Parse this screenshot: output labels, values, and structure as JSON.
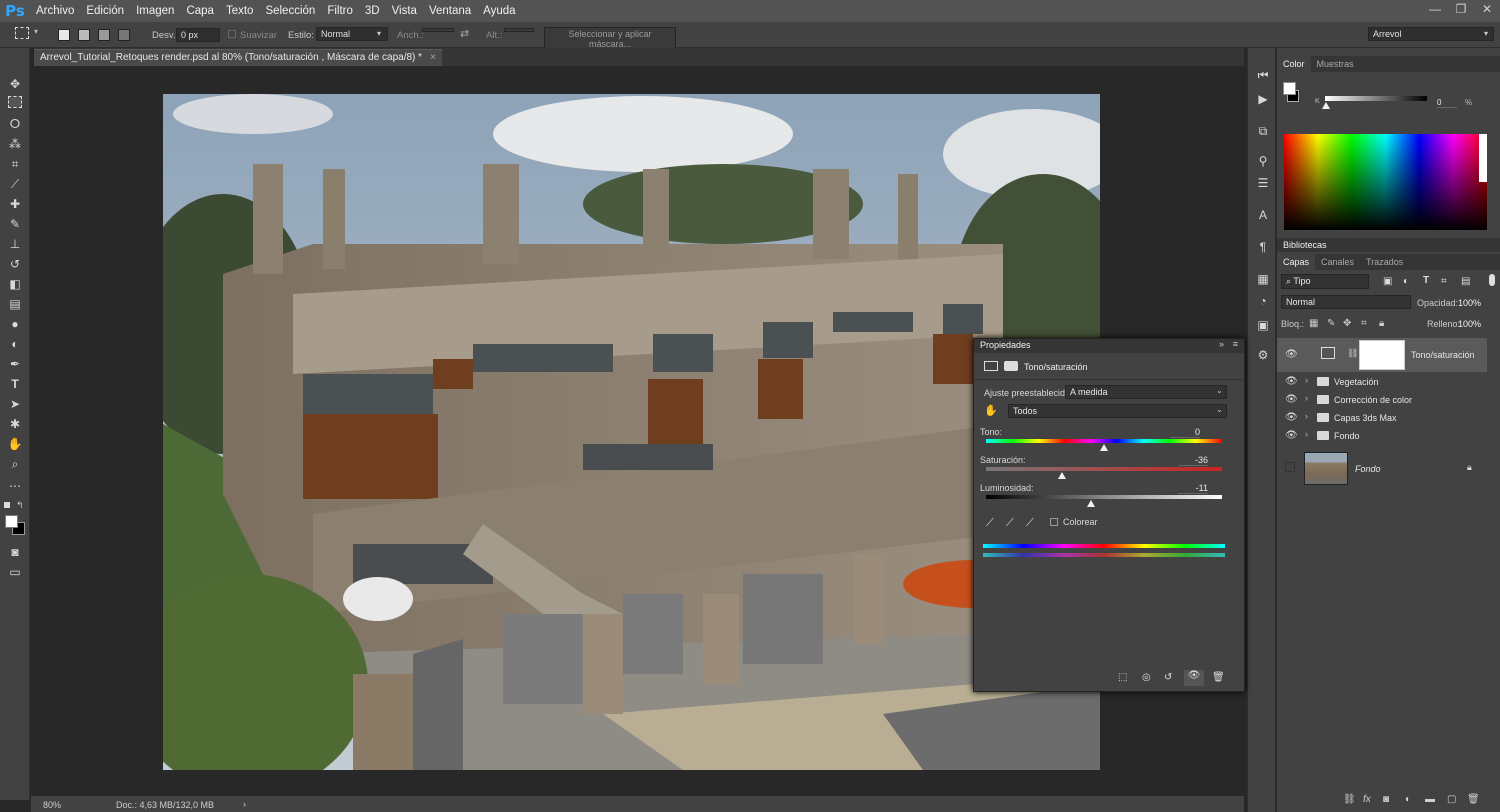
{
  "app": {
    "logo": "Ps"
  },
  "menu": [
    "Archivo",
    "Edición",
    "Imagen",
    "Capa",
    "Texto",
    "Selección",
    "Filtro",
    "3D",
    "Vista",
    "Ventana",
    "Ayuda"
  ],
  "window_controls": [
    "—",
    "❐",
    "✕"
  ],
  "options": {
    "feather_label": "Desv.:",
    "feather_value": "0 px",
    "smooth_label": "Suavizar",
    "style_label": "Estilo:",
    "style_value": "Normal",
    "width_label": "Anch.:",
    "height_label": "Alt.:",
    "mask_button": "Seleccionar y aplicar máscara...",
    "workspace": "Arrevol"
  },
  "document": {
    "tab_title": "Arrevol_Tutorial_Retoques render.psd al 80% (Tono/saturación , Máscara de capa/8) *",
    "close": "×"
  },
  "status": {
    "zoom": "80%",
    "doc": "Doc.: 4,63 MB/132,0 MB",
    "arrow": "›"
  },
  "color_panel": {
    "tabs": [
      "Color",
      "Muestras"
    ],
    "slider_label": "K",
    "value": "0",
    "unit": "%"
  },
  "libraries_panel": {
    "title": "Bibliotecas"
  },
  "layers_panel": {
    "tabs": [
      "Capas",
      "Canales",
      "Trazados"
    ],
    "filter_kind": "Tipo",
    "blend_mode": "Normal",
    "opacity_label": "Opacidad:",
    "opacity_value": "100%",
    "lock_label": "Bloq.:",
    "fill_label": "Relleno:",
    "fill_value": "100%",
    "layers": [
      {
        "name": "Tono/saturación",
        "type": "adjustment"
      },
      {
        "name": "Vegetación",
        "type": "group"
      },
      {
        "name": "Corrección de color",
        "type": "group"
      },
      {
        "name": "Capas 3ds Max",
        "type": "group"
      },
      {
        "name": "Fondo",
        "type": "group"
      },
      {
        "name": "Fondo",
        "type": "image"
      }
    ],
    "footer_icons": [
      "link-icon",
      "fx-icon",
      "mask-icon",
      "adjustment-icon",
      "folder-icon",
      "new-layer-icon",
      "trash-icon"
    ]
  },
  "properties_panel": {
    "title": "Propiedades",
    "adjustment_name": "Tono/saturación",
    "preset_label": "Ajuste preestablecido:",
    "preset_value": "A medida",
    "channel_value": "Todos",
    "hue_label": "Tono:",
    "hue_value": "0",
    "saturation_label": "Saturación:",
    "saturation_value": "-36",
    "lightness_label": "Luminosidad:",
    "lightness_value": "-11",
    "colorize_label": "Colorear",
    "hue_fraction": 0.5,
    "saturation_fraction": 0.32,
    "lightness_fraction": 0.445
  },
  "colors": {
    "brand": "#31a8ff",
    "panel": "#424242",
    "menubar": "#535353"
  }
}
